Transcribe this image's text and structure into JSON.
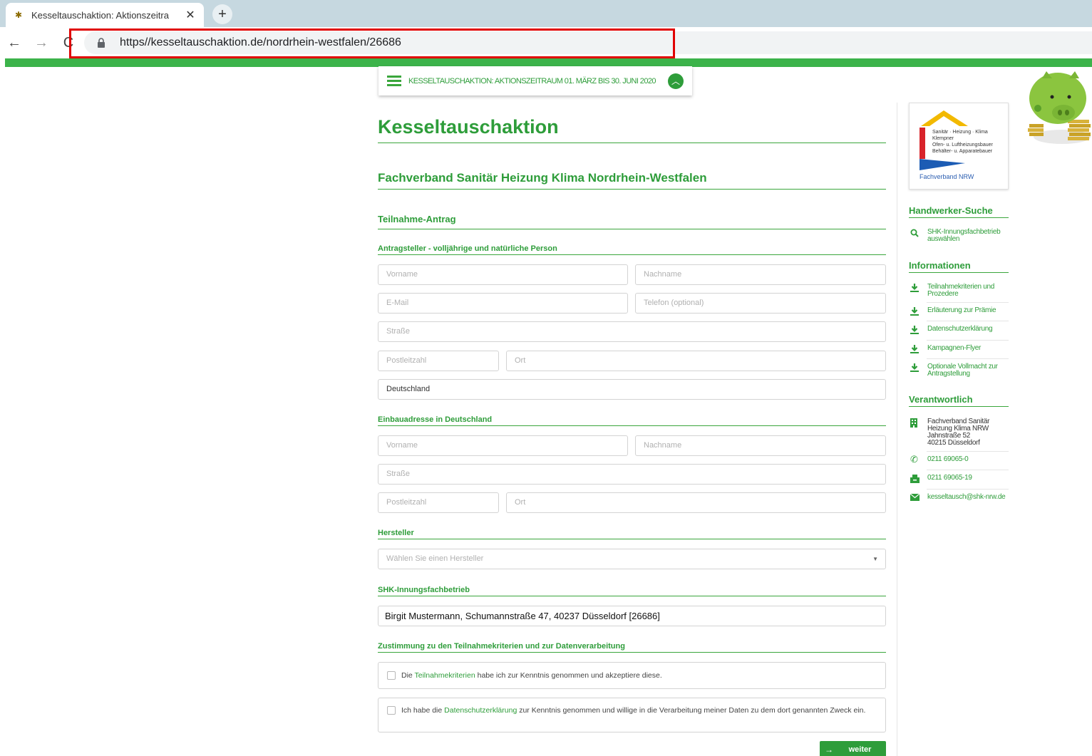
{
  "browser": {
    "tab_title": "Kesseltauschaktion: Aktionszeitra",
    "tab_close": "✕",
    "new_tab": "+",
    "back": "←",
    "forward": "→",
    "reload": "C",
    "url": "https//kesseltauschaktion.de/nordrhein-westfalen/26686"
  },
  "header": {
    "promo": "KESSELTAUSCHAKTION: AKTIONSZEITRAUM 01. MÄRZ BIS 30. JUNI 2020",
    "promo_toggle": "︿"
  },
  "main": {
    "title": "Kesseltauschaktion",
    "subtitle": "Fachverband Sanitär Heizung Klima Nordrhein-Westfalen",
    "form_title": "Teilnahme-Antrag",
    "applicant": {
      "heading": "Antragsteller - volljährige und natürliche Person",
      "vorname_placeholder": "Vorname",
      "nachname_placeholder": "Nachname",
      "email_placeholder": "E-Mail",
      "telefon_placeholder": "Telefon (optional)",
      "strasse_placeholder": "Straße",
      "plz_placeholder": "Postleitzahl",
      "ort_placeholder": "Ort",
      "land_value": "Deutschland"
    },
    "install": {
      "heading": "Einbauadresse in Deutschland",
      "vorname_placeholder": "Vorname",
      "nachname_placeholder": "Nachname",
      "strasse_placeholder": "Straße",
      "plz_placeholder": "Postleitzahl",
      "ort_placeholder": "Ort"
    },
    "manufacturer": {
      "heading": "Hersteller",
      "select_placeholder": "Wählen Sie einen Hersteller",
      "caret": "▼"
    },
    "company": {
      "heading": "SHK-Innungsfachbetrieb",
      "value": "Birgit Mustermann, Schumannstraße 47, 40237 Düsseldorf [26686]"
    },
    "consent": {
      "heading": "Zustimmung zu den Teilnahmekriterien und zur Datenverarbeitung",
      "c1_pre": "Die ",
      "c1_link": "Teilnahmekriterien",
      "c1_post": " habe ich zur Kenntnis genommen und akzeptiere diese.",
      "c2_pre": "Ich habe die ",
      "c2_link": "Datenschutzerklärung",
      "c2_post": " zur Kenntnis genommen und willige in die Verarbeitung meiner Daten zu dem dort genannten Zweck ein."
    },
    "submit_arrow": "→",
    "submit_label": "weiter"
  },
  "sidebar": {
    "logo": {
      "line1": "Sanitär · Heizung · Klima",
      "line2": "Klempner",
      "line3": "Ofen- u. Luftheizungsbauer",
      "line4": "Behälter- u. Apparatebauer",
      "footer": "Fachverband NRW"
    },
    "search_heading": "Handwerker-Suche",
    "search_link": "SHK-Innungsfachbetrieb auswählen",
    "info_heading": "Informationen",
    "info_items": [
      "Teilnahmekriterien und Prozedere",
      "Erläuterung zur Prämie",
      "Datenschutzerklärung",
      "Kampagnen-Flyer",
      "Optionale Vollmacht zur Antragstellung"
    ],
    "resp_heading": "Verantwortlich",
    "address_line1": "Fachverband Sanitär",
    "address_line2": "Heizung Klima NRW",
    "address_line3": "Jahnstraße 52",
    "address_line4": "40215 Düsseldorf",
    "phone": "0211 69065-0",
    "fax": "0211 69065-19",
    "email": "kesseltausch@shk-nrw.de"
  },
  "colors": {
    "brand_green": "#2e9d3a",
    "bar_green": "#3cb34a",
    "highlight_red": "#e00000"
  }
}
